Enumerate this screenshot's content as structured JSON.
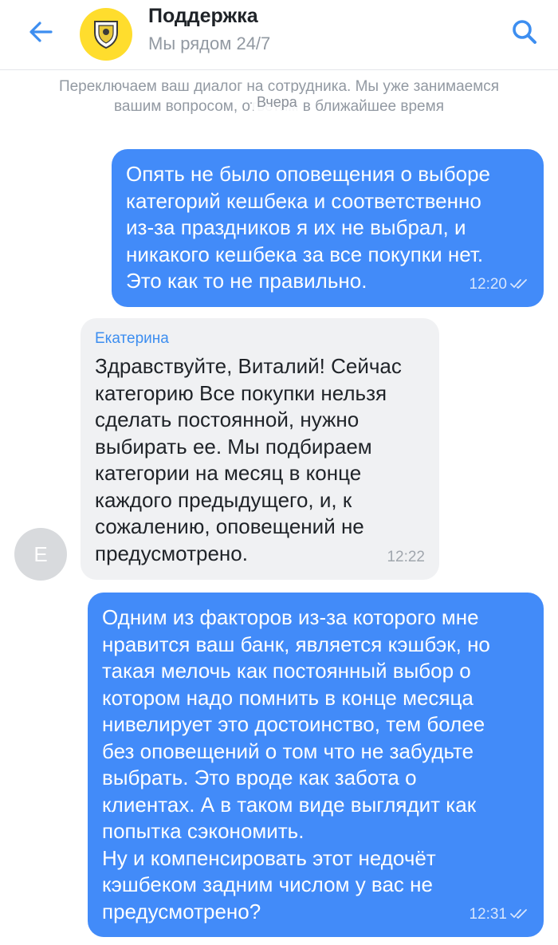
{
  "header": {
    "title": "Поддержка",
    "subtitle": "Мы рядом 24/7",
    "back_icon": "arrow-left-icon",
    "search_icon": "search-icon",
    "accent_color": "#3d8ef0",
    "logo_color": "#ffdd2d"
  },
  "system_note": "Переключаем ваш диалог на сотрудника. Мы уже занимаемся вашим вопросом, ответим в ближайшее время",
  "date_chip": "Вчера",
  "messages": [
    {
      "direction": "out",
      "text": "Опять не было оповещения о выборе\nкатегорий кешбека и соответственно\nиз-за праздников я их не выбрал, и\nникакого кешбека за все покупки нет.\nЭто как то не правильно.",
      "time": "12:20",
      "status_icon": "double-check-icon"
    },
    {
      "direction": "in",
      "sender": "Екатерина",
      "avatar_letter": "Е",
      "text": "Здравствуйте, Виталий! Сейчас\nкатегорию Все покупки нельзя\nсделать постоянной, нужно\nвыбирать ее. Мы подбираем\nкатегории на месяц в конце\nкаждого предыдущего, и, к\nсожалению, оповещений не\nпредусмотрено.",
      "time": "12:22"
    },
    {
      "direction": "out",
      "text": "Одним из факторов из-за которого мне\nнравится ваш банк, является кэшбэк, но\nтакая мелочь как постоянный выбор о\nкотором надо помнить в конце месяца\nнивелирует это достоинство, тем более\nбез оповещений о том что не забудьте\nвыбрать. Это вроде как забота о\nклиентах. А в таком виде выглядит как\nпопытка сэкономить.\nНу и компенсировать этот недочёт\nкэшбеком задним числом у вас не\nпредусмотрено?",
      "time": "12:31",
      "status_icon": "double-check-icon"
    }
  ]
}
